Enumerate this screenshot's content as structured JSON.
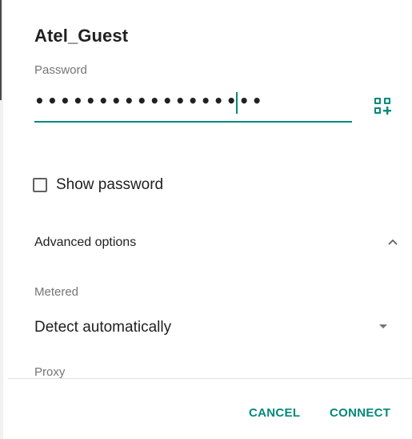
{
  "dialog": {
    "title": "Atel_Guest",
    "password_label": "Password",
    "password_masked": "••••••••••••••••••",
    "show_password_label": "Show password",
    "show_password_checked": false,
    "advanced_options_label": "Advanced options",
    "metered_label": "Metered",
    "metered_value": "Detect automatically",
    "proxy_label": "Proxy",
    "cancel_label": "CANCEL",
    "connect_label": "CONNECT"
  },
  "icons": {
    "qr": "qr-code-add-icon",
    "chevron_up": "chevron-up-icon",
    "dropdown": "dropdown-arrow-icon"
  },
  "colors": {
    "accent": "#00897b",
    "text_primary": "#212121",
    "text_secondary": "#757575",
    "divider": "#e0e0e0"
  }
}
